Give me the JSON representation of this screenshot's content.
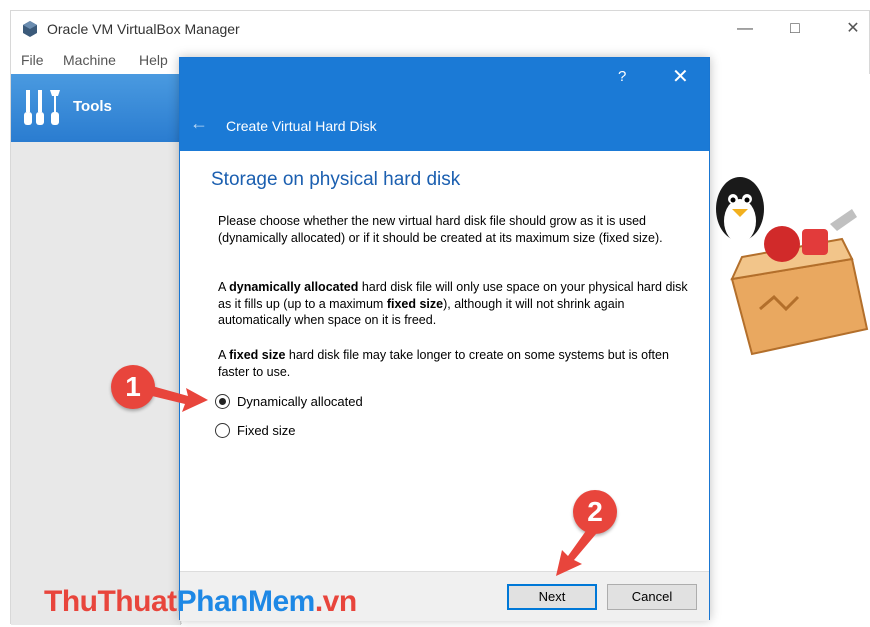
{
  "window": {
    "title": "Oracle VM VirtualBox Manager",
    "controls": [
      "minimize-icon",
      "maximize-icon",
      "close-icon"
    ]
  },
  "menu": {
    "items": [
      "File",
      "Machine",
      "Help"
    ]
  },
  "sidebar": {
    "tools_label": "Tools"
  },
  "dialog": {
    "help_label": "?",
    "title": "Create Virtual Hard Disk",
    "section_title": "Storage on physical hard disk",
    "paragraph1": "Please choose whether the new virtual hard disk file should grow as it is used (dynamically allocated) or if it should be created at its maximum size (fixed size).",
    "paragraph2": {
      "prefix": "A ",
      "bold1": "dynamically allocated",
      "middle": " hard disk file will only use space on your physical hard disk as it fills up (up to a maximum ",
      "bold2": "fixed size",
      "suffix": "), although it will not shrink again automatically when space on it is freed."
    },
    "paragraph3": {
      "prefix": "A ",
      "bold1": "fixed size",
      "suffix": " hard disk file may take longer to create on some systems but is often faster to use."
    },
    "options": [
      {
        "label": "Dynamically allocated",
        "checked": true
      },
      {
        "label": "Fixed size",
        "checked": false
      }
    ],
    "buttons": {
      "next": "Next",
      "cancel": "Cancel"
    }
  },
  "annotations": {
    "badge1": "1",
    "badge2": "2"
  },
  "watermark": {
    "part1": "ThuThuat",
    "part2": "PhanMem",
    "part3": ".vn"
  },
  "colors": {
    "accent": "#1b7ad6",
    "section_title": "#1b5fb0",
    "badge": "#e8453c",
    "watermark_red": "#e8453c",
    "watermark_blue": "#1e88e5"
  }
}
